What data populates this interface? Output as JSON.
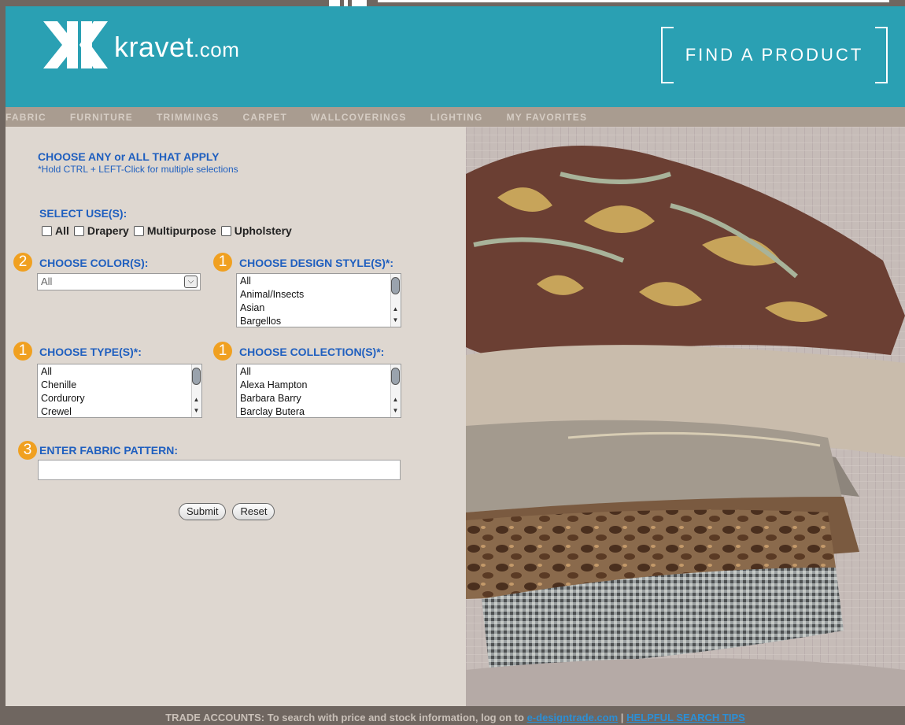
{
  "brand": {
    "name": "kravet",
    "suffix": ".com"
  },
  "header": {
    "find_product": "FIND A PRODUCT"
  },
  "nav": [
    "FABRIC",
    "FURNITURE",
    "TRIMMINGS",
    "CARPET",
    "WALLCOVERINGS",
    "LIGHTING",
    "MY FAVORITES"
  ],
  "form": {
    "heading": "CHOOSE ANY or ALL THAT APPLY",
    "subheading": "*Hold CTRL + LEFT-Click for multiple selections",
    "uses_label": "SELECT USE(S):",
    "uses": [
      "All",
      "Drapery",
      "Multipurpose",
      "Upholstery"
    ],
    "color": {
      "badge": "2",
      "label": "CHOOSE COLOR(S):",
      "selected": "All"
    },
    "design_style": {
      "badge": "1",
      "label": "CHOOSE DESIGN STYLE(S)*:",
      "options": [
        "All",
        "Animal/Insects",
        "Asian",
        "Bargellos"
      ]
    },
    "type": {
      "badge": "1",
      "label": "CHOOSE TYPE(S)*:",
      "options": [
        "All",
        "Chenille",
        "Cordurory",
        "Crewel"
      ]
    },
    "collection": {
      "badge": "1",
      "label": "CHOOSE COLLECTION(S)*:",
      "options": [
        "All",
        "Alexa Hampton",
        "Barbara Barry",
        "Barclay Butera"
      ]
    },
    "pattern": {
      "badge": "3",
      "label": "ENTER FABRIC PATTERN:",
      "value": ""
    },
    "submit_label": "Submit",
    "reset_label": "Reset"
  },
  "footer": {
    "text": "TRADE ACCOUNTS: To search with price and stock information, log on to",
    "link1": "e-designtrade.com",
    "separator": "|",
    "link2": "HELPFUL SEARCH TIPS"
  },
  "colors": {
    "header": "#2aa0b3",
    "nav": "#a99c90",
    "form_bg": "#ded7d0",
    "badge": "#f0a020",
    "label_blue": "#1f5fbf",
    "frame": "#6f6660"
  }
}
